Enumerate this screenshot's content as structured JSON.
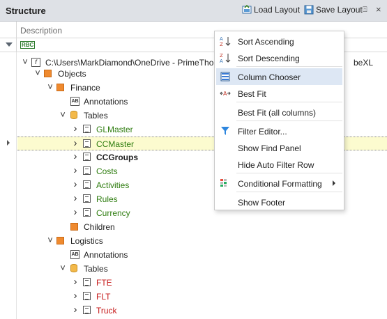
{
  "panel": {
    "title": "Structure",
    "load_layout": "Load Layout",
    "save_layout": "Save Layout",
    "pin_glyph": "⍐",
    "close_glyph": "×"
  },
  "grid": {
    "column_header": "Description",
    "filter_icon_text": "RBC",
    "rows": [
      {
        "label": "C:\\Users\\MarkDiamond\\OneDrive - PrimeThought S",
        "label_tail": "beXL",
        "icon": "fx-icon",
        "color": "black"
      },
      {
        "label": "Objects",
        "icon": "object-icon",
        "color": "black"
      },
      {
        "label": "Finance",
        "icon": "object-icon",
        "color": "black"
      },
      {
        "label": "Annotations",
        "icon": "annotation-icon",
        "color": "black"
      },
      {
        "label": "Tables",
        "icon": "database-icon",
        "color": "black"
      },
      {
        "label": "GLMaster",
        "icon": "table-icon",
        "color": "green"
      },
      {
        "label": "CCMaster",
        "icon": "table-icon",
        "color": "green"
      },
      {
        "label": "CCGroups",
        "icon": "table-icon",
        "color": "bold"
      },
      {
        "label": "Costs",
        "icon": "table-icon",
        "color": "green"
      },
      {
        "label": "Activities",
        "icon": "table-icon",
        "color": "green"
      },
      {
        "label": "Rules",
        "icon": "table-icon",
        "color": "green"
      },
      {
        "label": "Currency",
        "icon": "table-icon",
        "color": "green"
      },
      {
        "label": "Children",
        "icon": "object-icon",
        "color": "black"
      },
      {
        "label": "Logistics",
        "icon": "object-icon",
        "color": "black"
      },
      {
        "label": "Annotations",
        "icon": "annotation-icon",
        "color": "black"
      },
      {
        "label": "Tables",
        "icon": "database-icon",
        "color": "black"
      },
      {
        "label": "FTE",
        "icon": "table-icon",
        "color": "red"
      },
      {
        "label": "FLT",
        "icon": "table-icon",
        "color": "red"
      },
      {
        "label": "Truck",
        "icon": "table-icon",
        "color": "red"
      }
    ],
    "selected_row": "CCMaster"
  },
  "context_menu": {
    "items": [
      {
        "label": "Sort Ascending",
        "icon": "sort-ascending-icon"
      },
      {
        "label": "Sort Descending",
        "icon": "sort-descending-icon"
      },
      {
        "label": "Column Chooser",
        "icon": "column-chooser-icon",
        "active": true
      },
      {
        "label": "Best Fit",
        "icon": "best-fit-icon"
      },
      {
        "label": "Best Fit (all columns)",
        "icon": ""
      },
      {
        "label": "Filter Editor...",
        "icon": "filter-icon"
      },
      {
        "label": "Show Find Panel",
        "icon": ""
      },
      {
        "label": "Hide Auto Filter Row",
        "icon": ""
      },
      {
        "label": "Conditional Formatting",
        "icon": "conditional-formatting-icon",
        "submenu": true
      },
      {
        "label": "Show Footer",
        "icon": ""
      }
    ]
  },
  "colors": {
    "green_text": "#2f7d10",
    "red_text": "#c61a1a",
    "selection": "#fcfbcf",
    "menu_highlight": "#dde7f4",
    "object_orange": "#ef8a2f"
  }
}
